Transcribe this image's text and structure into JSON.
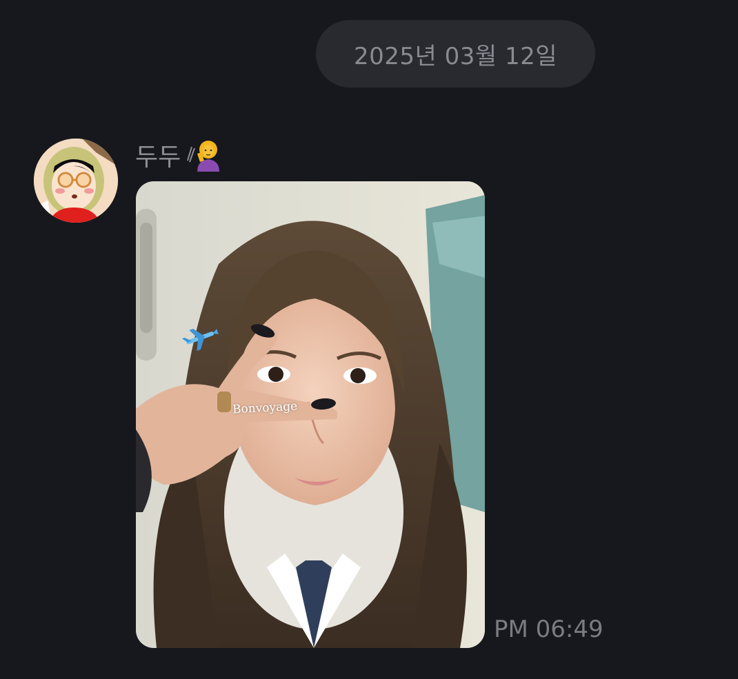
{
  "chat": {
    "date_divider": "2025년 03월 12일",
    "message": {
      "sender_name": "두두",
      "sender_emoji_icon": "woman-tipping-hand-emoji-icon",
      "photo_sticker_text": "Bonvoyage",
      "photo_sticker_icon": "airplane-icon",
      "time": "PM 06:49"
    }
  },
  "colors": {
    "background": "#17181d",
    "pill_background": "#292a30",
    "muted_text": "#8a8b92"
  }
}
